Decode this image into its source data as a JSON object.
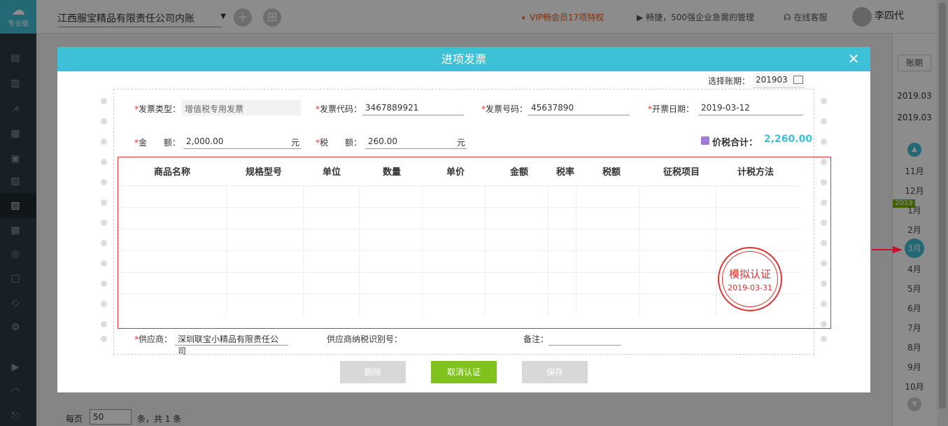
{
  "sidebar": {
    "logo_edition": "专业版"
  },
  "header": {
    "company": "江西服宝精品有限责任公司内账",
    "vip_text": "VIP畅会员17项特权",
    "promo_text": "畅捷，500强企业急需的管理",
    "service_text": "在线客服",
    "user_name": "李四代"
  },
  "period_panel": {
    "label": "账期",
    "date_start": "2019.03",
    "date_end": "2019.03",
    "year_tag": "2019",
    "months": [
      "11月",
      "12月",
      "1月",
      "2月",
      "3月",
      "4月",
      "5月",
      "6月",
      "7月",
      "8月",
      "9月",
      "10月"
    ],
    "active_month": "3月"
  },
  "bottom_bar": {
    "per_page_label": "每页",
    "per_page_value": "50",
    "total_text": "条，共 1 条"
  },
  "modal": {
    "title": "进项发票",
    "period_label": "选择账期：",
    "period_value": "201903",
    "fields": {
      "invoice_type_label": "发票类型：",
      "invoice_type_value": "增值税专用发票",
      "invoice_code_label": "发票代码：",
      "invoice_code_value": "3467889921",
      "invoice_number_label": "发票号码：",
      "invoice_number_value": "45637890",
      "invoice_date_label": "开票日期：",
      "invoice_date_value": "2019-03-12",
      "amount_label": "金　　额：",
      "amount_value": "2,000.00",
      "amount_unit": "元",
      "tax_label": "税　　额：",
      "tax_value": "260.00",
      "tax_unit": "元",
      "total_label": "价税合计：",
      "total_value": "2,260.00",
      "supplier_label": "供应商：",
      "supplier_value": "深圳联宝小精品有限责任公司",
      "supplier_tax_id_label": "供应商纳税识别号：",
      "supplier_tax_id_value": "",
      "remark_label": "备注：",
      "remark_value": ""
    },
    "table_headers": [
      "商品名称",
      "规格型号",
      "单位",
      "数量",
      "单价",
      "金额",
      "税率",
      "税额",
      "征税项目",
      "计税方法"
    ],
    "stamp": {
      "title": "模拟认证",
      "date": "2019-03-31"
    },
    "buttons": {
      "delete": "删除",
      "cancel_cert": "取消认证",
      "save": "保存"
    }
  },
  "colors": {
    "accent": "#3ec0d6",
    "green": "#80c21e",
    "stamp_red": "#dd3333"
  }
}
